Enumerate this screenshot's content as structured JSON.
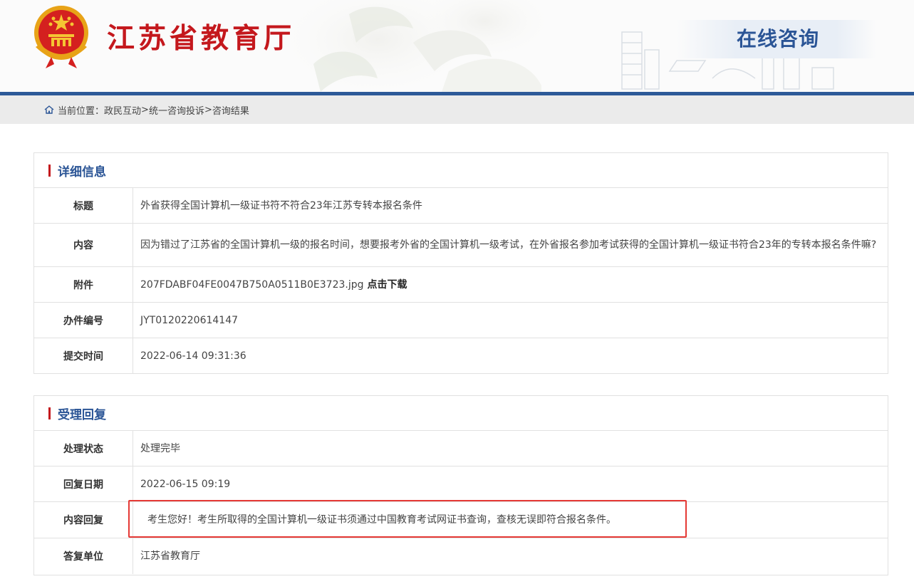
{
  "header": {
    "site_title": "江苏省教育厅",
    "section_title": "在线咨询",
    "emblem": "national-emblem"
  },
  "breadcrumb": {
    "prefix": "当前位置：",
    "items": [
      "政民互动",
      "统一咨询投诉",
      "咨询结果"
    ],
    "separator": ">"
  },
  "detail": {
    "title": "详细信息",
    "rows": {
      "subject_label": "标题",
      "subject_value": "外省获得全国计算机一级证书符不符合23年江苏专转本报名条件",
      "content_label": "内容",
      "content_value": "因为错过了江苏省的全国计算机一级的报名时间，想要报考外省的全国计算机一级考试，在外省报名参加考试获得的全国计算机一级证书符合23年的专转本报名条件嘛?",
      "attachment_label": "附件",
      "attachment_name": "207FDABF04FE0047B750A0511B0E3723.jpg",
      "attachment_download": "点击下载",
      "case_no_label": "办件编号",
      "case_no_value": "JYT0120220614147",
      "submit_time_label": "提交时间",
      "submit_time_value": "2022-06-14 09:31:36"
    }
  },
  "reply": {
    "title": "受理回复",
    "rows": {
      "status_label": "处理状态",
      "status_value": "处理完毕",
      "date_label": "回复日期",
      "date_value": "2022-06-15 09:19",
      "content_label": "内容回复",
      "content_value": "考生您好！考生所取得的全国计算机一级证书须通过中国教育考试网证书查询，查核无误即符合报名条件。",
      "unit_label": "答复单位",
      "unit_value": "江苏省教育厅"
    }
  },
  "colors": {
    "brand_red": "#c4181d",
    "brand_blue": "#2b5596",
    "highlight_box": "#e53935"
  }
}
